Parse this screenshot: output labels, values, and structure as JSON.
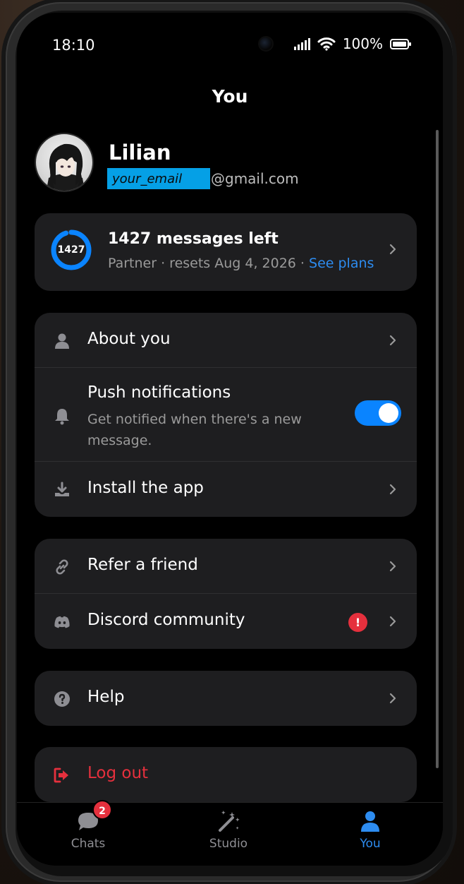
{
  "status_bar": {
    "time": "18:10",
    "battery": "100%"
  },
  "page_title": "You",
  "profile": {
    "name": "Lilian",
    "email_mask": "your_email",
    "email_domain": "@gmail.com"
  },
  "usage": {
    "ring_value": "1427",
    "title": "1427 messages left",
    "subtitle": "Partner · resets Aug 4, 2026 · ",
    "link": "See plans",
    "remaining_fraction": 0.95
  },
  "settings": {
    "about": "About you",
    "push_title": "Push notifications",
    "push_sub": "Get notified when there's a new message.",
    "push_enabled": true,
    "install": "Install the app"
  },
  "social": {
    "refer": "Refer a friend",
    "discord": "Discord community",
    "discord_badge": "!"
  },
  "help": {
    "label": "Help"
  },
  "logout": {
    "label": "Log out"
  },
  "nav": {
    "chats": "Chats",
    "chats_badge": "2",
    "studio": "Studio",
    "you": "You"
  },
  "colors": {
    "accent": "#2d8cf0",
    "danger": "#e5303d",
    "card": "#1e1e20",
    "toggle_on": "#0a84ff"
  }
}
